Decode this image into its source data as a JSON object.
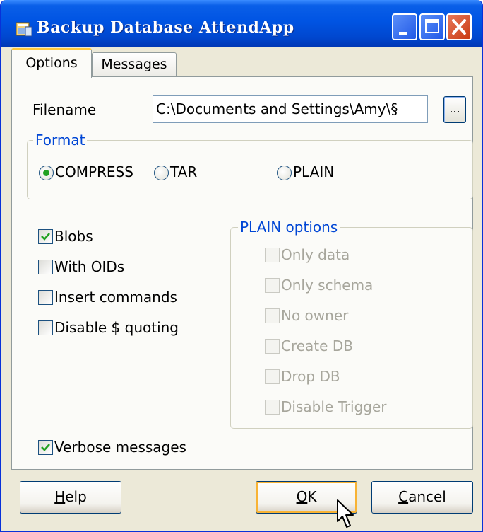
{
  "window": {
    "title": "Backup Database AttendApp",
    "controls": [
      "minimize-icon",
      "maximize-icon",
      "close-icon"
    ]
  },
  "tabs": [
    {
      "label": "Options",
      "selected": true
    },
    {
      "label": "Messages",
      "selected": false
    }
  ],
  "filename": {
    "label": "Filename",
    "value": "C:\\Documents and Settings\\Amy\\§",
    "browse_label": "..."
  },
  "format": {
    "title": "Format",
    "options": [
      {
        "label": "COMPRESS",
        "checked": true
      },
      {
        "label": "TAR",
        "checked": false
      },
      {
        "label": "PLAIN",
        "checked": false
      }
    ]
  },
  "options": [
    {
      "label": "Blobs",
      "checked": true
    },
    {
      "label": "With OIDs",
      "checked": false
    },
    {
      "label": "Insert commands",
      "checked": false
    },
    {
      "label": "Disable $ quoting",
      "checked": false
    }
  ],
  "plain_options": {
    "title": "PLAIN options",
    "items": [
      {
        "label": "Only data",
        "checked": false,
        "enabled": false
      },
      {
        "label": "Only schema",
        "checked": false,
        "enabled": false
      },
      {
        "label": "No owner",
        "checked": false,
        "enabled": false
      },
      {
        "label": "Create DB",
        "checked": false,
        "enabled": false
      },
      {
        "label": "Drop DB",
        "checked": false,
        "enabled": false
      },
      {
        "label": "Disable Trigger",
        "checked": false,
        "enabled": false
      }
    ]
  },
  "verbose": {
    "label": "Verbose messages",
    "checked": true
  },
  "buttons": {
    "help": {
      "pre": "",
      "mnemonic": "H",
      "post": "elp"
    },
    "ok": {
      "pre": "",
      "mnemonic": "O",
      "post": "K"
    },
    "cancel": {
      "pre": "",
      "mnemonic": "C",
      "post": "ancel"
    }
  },
  "colors": {
    "titlebar": "#0054E3",
    "group_title": "#0046D5",
    "check_mark": "#21A121",
    "default_button_border": "#F8B334"
  }
}
